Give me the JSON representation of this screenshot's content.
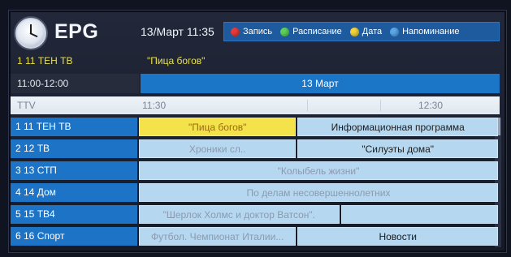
{
  "header": {
    "title": "EPG",
    "datetime": "13/Март 11:35",
    "legend": [
      {
        "label": "Запись",
        "color": "#e83a3a"
      },
      {
        "label": "Расписание",
        "color": "#5fd05a"
      },
      {
        "label": "Дата",
        "color": "#f4d43a"
      },
      {
        "label": "Напоминание",
        "color": "#5aa8ea"
      }
    ]
  },
  "current": {
    "channel": "1 11 ТЕН ТВ",
    "program": "\"Пица богов\""
  },
  "time_row": {
    "range": "11:00-12:00",
    "date": "13 Март"
  },
  "timeline": {
    "channel": "TTV",
    "t1": "11:30",
    "t2": "12:30"
  },
  "channels": [
    {
      "name": "1 11 ТЕН ТВ",
      "programs": [
        {
          "title": "\"Пица богов\"",
          "state": "selected",
          "start": 0,
          "width": 0.44
        },
        {
          "title": "Информационная программа",
          "state": "active",
          "start": 0.44,
          "width": 0.56
        }
      ]
    },
    {
      "name": "2 12 ТВ",
      "programs": [
        {
          "title": "Хроники сл..",
          "state": "inactive",
          "start": 0,
          "width": 0.44
        },
        {
          "title": "\"Силуэты дома\"",
          "state": "active",
          "start": 0.44,
          "width": 0.56
        }
      ]
    },
    {
      "name": "3 13 СТП",
      "programs": [
        {
          "title": "\"Колыбель жизни\"",
          "state": "inactive",
          "start": 0,
          "width": 1
        }
      ]
    },
    {
      "name": "4 14 Дом",
      "programs": [
        {
          "title": "По делам несовершеннолетних",
          "state": "inactive",
          "start": 0,
          "width": 1
        }
      ]
    },
    {
      "name": "5 15 ТВ4",
      "programs": [
        {
          "title": "\"Шерлок Холмс и доктор Ватсон\".",
          "state": "inactive",
          "start": 0,
          "width": 0.56
        },
        {
          "title": "",
          "state": "inactive",
          "start": 0.56,
          "width": 0.44
        }
      ]
    },
    {
      "name": "6 16 Спорт",
      "programs": [
        {
          "title": "Футбол. Чемпионат Италии...",
          "state": "inactive",
          "start": 0,
          "width": 0.44
        },
        {
          "title": "Новости",
          "state": "active",
          "start": 0.44,
          "width": 0.56
        }
      ]
    }
  ]
}
